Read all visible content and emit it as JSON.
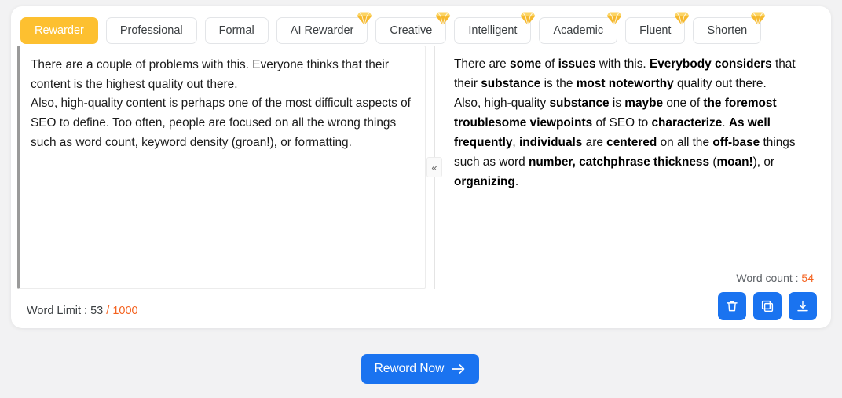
{
  "colors": {
    "page_background": "#f2f2f3",
    "card_background": "#ffffff",
    "accent_amber": "#fdc030",
    "accent_blue": "#1a73f0",
    "accent_orange": "#f4621f",
    "gem_badge": "#f9c23c"
  },
  "tabs": [
    {
      "label": "Rewarder",
      "active": true,
      "premium": false
    },
    {
      "label": "Professional",
      "active": false,
      "premium": false
    },
    {
      "label": "Formal",
      "active": false,
      "premium": false
    },
    {
      "label": "AI Rewarder",
      "active": false,
      "premium": true
    },
    {
      "label": "Creative",
      "active": false,
      "premium": true
    },
    {
      "label": "Intelligent",
      "active": false,
      "premium": true
    },
    {
      "label": "Academic",
      "active": false,
      "premium": true
    },
    {
      "label": "Fluent",
      "active": false,
      "premium": true
    },
    {
      "label": "Shorten",
      "active": false,
      "premium": true
    }
  ],
  "input_panel": {
    "text": "There are a couple of problems with this. Everyone thinks that their content is the highest quality out there.\nAlso, high-quality content is perhaps one of the most difficult aspects of SEO to define. Too often, people are focused on all the wrong things such as word count, keyword density (groan!), or formatting.",
    "placeholder": ""
  },
  "output_panel": {
    "segments": [
      {
        "t": "There are ",
        "b": false
      },
      {
        "t": "some",
        "b": true
      },
      {
        "t": " of ",
        "b": false
      },
      {
        "t": "issues",
        "b": true
      },
      {
        "t": " with this. ",
        "b": false
      },
      {
        "t": "Everybody considers",
        "b": true
      },
      {
        "t": " that their ",
        "b": false
      },
      {
        "t": "substance",
        "b": true
      },
      {
        "t": " is the ",
        "b": false
      },
      {
        "t": "most noteworthy",
        "b": true
      },
      {
        "t": " quality out there.\nAlso, high-quality ",
        "b": false
      },
      {
        "t": "substance",
        "b": true
      },
      {
        "t": " is ",
        "b": false
      },
      {
        "t": "maybe",
        "b": true
      },
      {
        "t": " one of ",
        "b": false
      },
      {
        "t": "the foremost troublesome viewpoints",
        "b": true
      },
      {
        "t": " of SEO to ",
        "b": false
      },
      {
        "t": "characterize",
        "b": true
      },
      {
        "t": ". ",
        "b": false
      },
      {
        "t": "As well frequently",
        "b": true
      },
      {
        "t": ", ",
        "b": false
      },
      {
        "t": "individuals",
        "b": true
      },
      {
        "t": " are ",
        "b": false
      },
      {
        "t": "centered",
        "b": true
      },
      {
        "t": " on all the ",
        "b": false
      },
      {
        "t": "off-base",
        "b": true
      },
      {
        "t": " things such as word ",
        "b": false
      },
      {
        "t": "number, catchphrase thickness",
        "b": true
      },
      {
        "t": " (",
        "b": false
      },
      {
        "t": "moan!",
        "b": true
      },
      {
        "t": "), or ",
        "b": false
      },
      {
        "t": "organizing",
        "b": true
      },
      {
        "t": ".",
        "b": false
      }
    ],
    "word_count_label": "Word count : ",
    "word_count_value": "54"
  },
  "divider": {
    "collapse_icon": "chevron-double-left-icon",
    "collapse_glyph": "«"
  },
  "footer": {
    "word_limit_label": "Word Limit : ",
    "word_limit_current": "53",
    "word_limit_max": " / 1000",
    "actions": [
      {
        "name": "delete-button",
        "icon": "trash-icon"
      },
      {
        "name": "copy-button",
        "icon": "copy-icon"
      },
      {
        "name": "download-button",
        "icon": "download-icon"
      }
    ]
  },
  "primary_action": {
    "label": "Reword Now",
    "icon": "arrow-right-icon"
  }
}
